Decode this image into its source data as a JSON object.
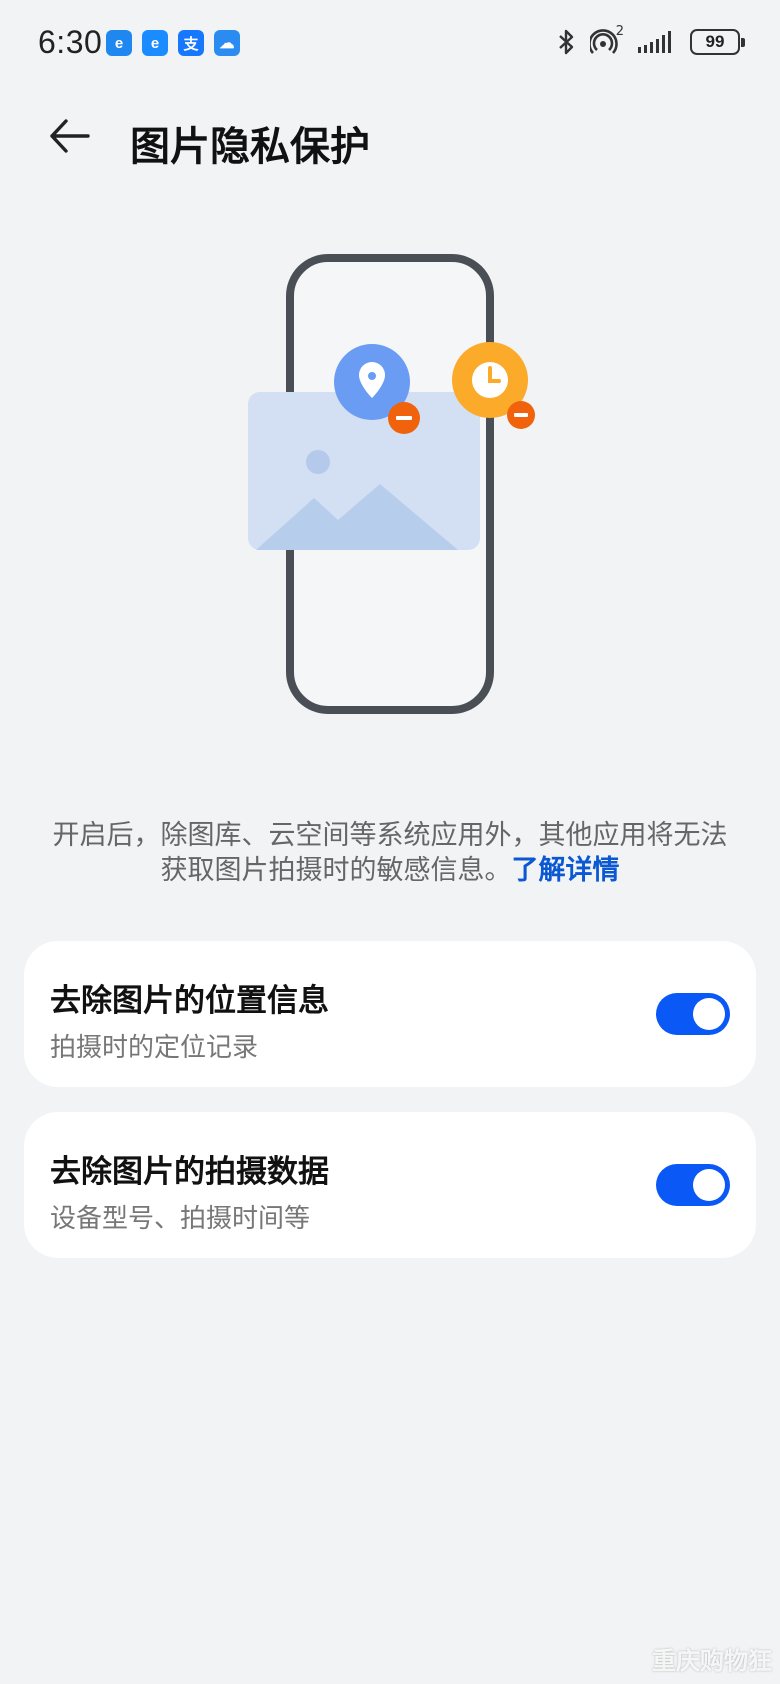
{
  "status_bar": {
    "time": "6:30",
    "notification_icons": [
      {
        "name": "browser-app-icon",
        "glyph": "e",
        "color": "#1f87f0"
      },
      {
        "name": "eleme-app-icon",
        "glyph": "e",
        "color": "#1a8cff"
      },
      {
        "name": "alipay-app-icon",
        "glyph": "支",
        "color": "#1677ff"
      },
      {
        "name": "weather-app-icon",
        "glyph": "☁",
        "color": "#2a8cf0"
      }
    ],
    "hotspot_count": "2",
    "battery": "99"
  },
  "header": {
    "title": "图片隐私保护"
  },
  "description": {
    "text": "开启后，除图库、云空间等系统应用外，其他应用将无法获取图片拍摄时的敏感信息。",
    "link": "了解详情"
  },
  "settings": [
    {
      "title": "去除图片的位置信息",
      "subtitle": "拍摄时的定位记录",
      "enabled": true
    },
    {
      "title": "去除图片的拍摄数据",
      "subtitle": "设备型号、拍摄时间等",
      "enabled": true
    }
  ],
  "colors": {
    "accent": "#0a59f7",
    "link": "#0a59d2",
    "location_badge": "#6b9cf4",
    "time_badge": "#fbaa2a",
    "remove_badge": "#f0620c"
  },
  "watermark": "重庆购物狂"
}
